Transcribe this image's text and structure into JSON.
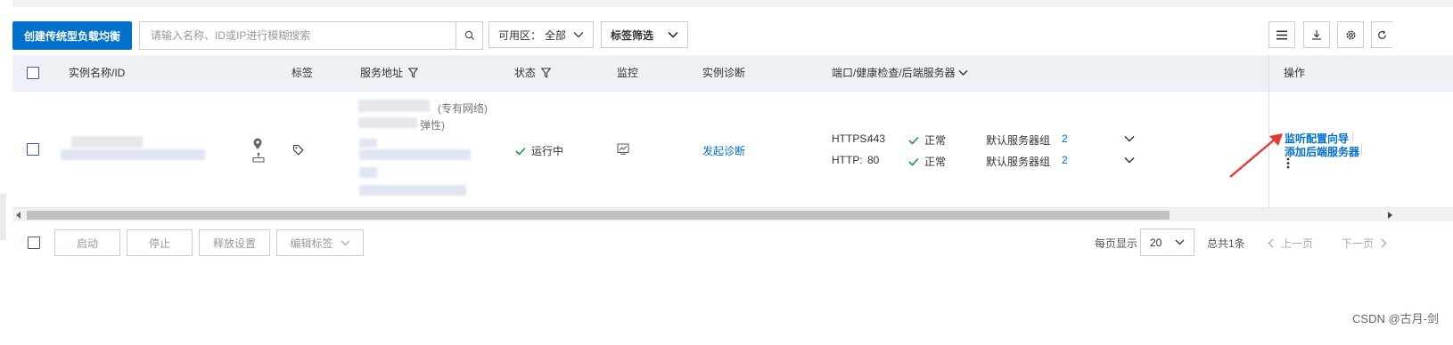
{
  "toolbar": {
    "create_label": "创建传统型负载均衡",
    "search_placeholder": "请输入名称、ID或IP进行模糊搜索",
    "zone_label": "可用区：",
    "zone_value": "全部",
    "tag_filter_label": "标签筛选"
  },
  "table": {
    "headers": {
      "name": "实例名称/ID",
      "tags": "标签",
      "address": "服务地址",
      "status": "状态",
      "monitor": "监控",
      "diagnosis": "实例诊断",
      "ports": "端口/健康检查/后端服务器",
      "actions": "操作"
    },
    "row": {
      "network_type": "(专有网络)",
      "elastic_suffix": "弹性)",
      "status": "运行中",
      "diagnosis_link": "发起诊断",
      "listeners": [
        {
          "protocol": "HTTPS:",
          "port": "443",
          "health": "正常",
          "group": "默认服务器组",
          "count": "2"
        },
        {
          "protocol": "HTTP:",
          "port": "80",
          "health": "正常",
          "group": "默认服务器组",
          "count": "2"
        }
      ],
      "action_wizard": "监听配置向导",
      "action_add_backend": "添加后端服务器"
    }
  },
  "bottom": {
    "start": "启动",
    "stop": "停止",
    "release": "释放设置",
    "edit_tags": "编辑标签",
    "per_page_label": "每页显示",
    "per_page_value": "20",
    "total": "总共1条",
    "prev": "上一页",
    "next": "下一页"
  },
  "watermark": "CSDN @古月-剑",
  "colors": {
    "primary": "#0070cc",
    "success": "#1a9b3b",
    "annotation": "#e53935"
  }
}
